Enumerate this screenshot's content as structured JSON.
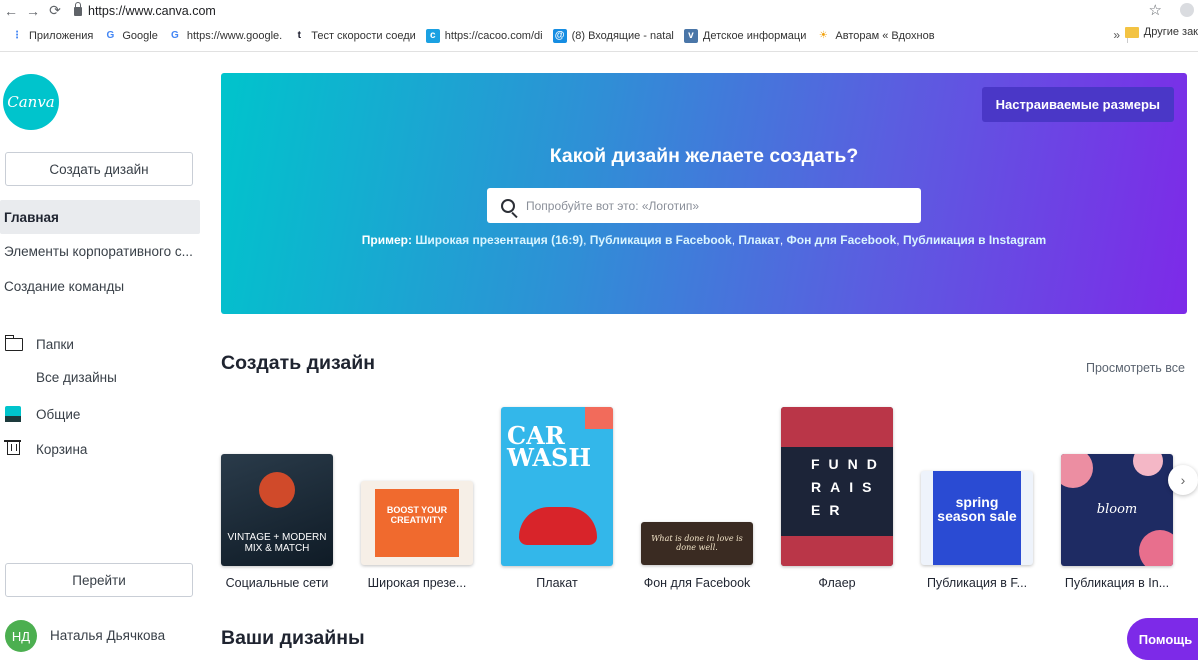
{
  "browser": {
    "url": "https://www.canva.com",
    "bookmarks": [
      {
        "label": "Приложения",
        "icon": "apps-grid-icon",
        "color": "#4285f4"
      },
      {
        "label": "Google",
        "icon": "google-icon",
        "color": "#4285f4"
      },
      {
        "label": "https://www.google.",
        "icon": "google-icon",
        "color": "#4285f4"
      },
      {
        "label": "Тест скорости соеди",
        "icon": "speedtest-icon",
        "color": "#141526"
      },
      {
        "label": "https://cacoo.com/di",
        "icon": "cacoo-icon",
        "color": "#1ba1e2"
      },
      {
        "label": "(8) Входящие - natal",
        "icon": "mail-icon",
        "color": "#168de2"
      },
      {
        "label": "Детское информаци",
        "icon": "vk-icon",
        "color": "#4a76a8"
      },
      {
        "label": "Авторам « Вдохнов",
        "icon": "sun-icon",
        "color": "#f2a20d"
      }
    ],
    "more": "»",
    "other_bookmarks": "Другие зак"
  },
  "sidebar": {
    "logo": "Canva",
    "create_button": "Создать дизайн",
    "nav": {
      "home": "Главная",
      "brand": "Элементы корпоративного с...",
      "team": "Создание команды"
    },
    "folders": "Папки",
    "all_designs": "Все дизайны",
    "shared": "Общие",
    "trash": "Корзина",
    "goto_button": "Перейти",
    "user": {
      "initials": "НД",
      "name": "Наталья Дьячкова"
    }
  },
  "hero": {
    "custom_size": "Настраиваемые размеры",
    "title": "Какой дизайн желаете создать?",
    "search_placeholder": "Попробуйте вот это: «Логотип»",
    "examples_label": "Пример:",
    "examples": [
      "Широкая презентация (16:9)",
      "Публикация в Facebook",
      "Плакат",
      "Фон для Facebook",
      "Публикация в Instagram"
    ]
  },
  "create_section": {
    "title": "Создать дизайн",
    "view_all": "Просмотреть все",
    "templates": [
      {
        "label": "Социальные сети",
        "thumb_text": "VINTAGE + MODERN MIX & MATCH"
      },
      {
        "label": "Широкая презе...",
        "thumb_text": "BOOST YOUR CREATIVITY"
      },
      {
        "label": "Плакат",
        "thumb_text": "CAR WASH"
      },
      {
        "label": "Фон для Facebook",
        "thumb_text": "What is done in love is done well."
      },
      {
        "label": "Флаер",
        "thumb_text": "FUND RAIS ER"
      },
      {
        "label": "Публикация в F...",
        "thumb_text": "spring season sale"
      },
      {
        "label": "Публикация в In...",
        "thumb_text": "bloom"
      }
    ]
  },
  "your_designs": {
    "title": "Ваши дизайны"
  },
  "help_button": "Помощь",
  "colors": {
    "accent": "#7d2ae8",
    "teal": "#00c4cc"
  }
}
